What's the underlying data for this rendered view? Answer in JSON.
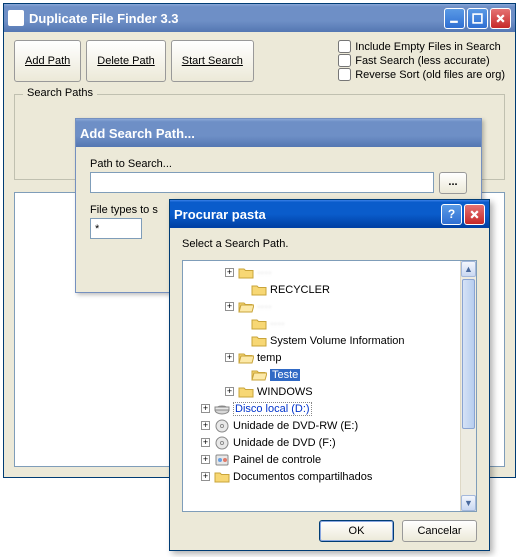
{
  "main": {
    "title": "Duplicate File Finder 3.3",
    "buttons": {
      "add_path": "Add Path",
      "delete_path": "Delete Path",
      "start_search": "Start Search"
    },
    "checks": {
      "include_empty": "Include Empty Files in Search",
      "fast_search": "Fast Search (less accurate)",
      "reverse_sort": "Reverse Sort (old files are org)"
    },
    "search_paths_label": "Search Paths"
  },
  "addpath": {
    "title": "Add Search Path...",
    "path_label": "Path to Search...",
    "path_value": "",
    "browse_label": "...",
    "types_label": "File types to s",
    "types_value": "*"
  },
  "browse": {
    "title": "Procurar pasta",
    "instruction": "Select a Search Path.",
    "ok": "OK",
    "cancel": "Cancelar",
    "tree": [
      {
        "indent": 42,
        "pm": "+",
        "icon": "folder",
        "label_obscured": true,
        "label": ""
      },
      {
        "indent": 55,
        "pm": "",
        "icon": "folder",
        "label": "RECYCLER"
      },
      {
        "indent": 42,
        "pm": "+",
        "icon": "folder-open",
        "label_obscured": true,
        "label": ""
      },
      {
        "indent": 55,
        "pm": "",
        "icon": "folder",
        "label_obscured": true,
        "label": ""
      },
      {
        "indent": 55,
        "pm": "",
        "icon": "folder",
        "label": "System Volume Information"
      },
      {
        "indent": 42,
        "pm": "+",
        "icon": "folder-open",
        "label": "temp"
      },
      {
        "indent": 55,
        "pm": "",
        "icon": "folder-open",
        "label": "Teste",
        "selected": true
      },
      {
        "indent": 42,
        "pm": "+",
        "icon": "folder",
        "label": "WINDOWS"
      },
      {
        "indent": 18,
        "pm": "+",
        "icon": "drive",
        "label": "Disco local (D:)",
        "link": true,
        "dotted": true
      },
      {
        "indent": 18,
        "pm": "+",
        "icon": "cd",
        "label": "Unidade de DVD-RW (E:)"
      },
      {
        "indent": 18,
        "pm": "+",
        "icon": "cd",
        "label": "Unidade de DVD (F:)"
      },
      {
        "indent": 18,
        "pm": "+",
        "icon": "control",
        "label": "Painel de controle"
      },
      {
        "indent": 18,
        "pm": "+",
        "icon": "folder",
        "label": "Documentos compartilhados"
      }
    ]
  }
}
